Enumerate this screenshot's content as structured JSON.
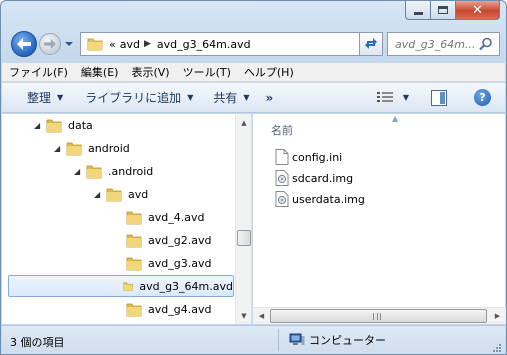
{
  "window": {
    "controls": {
      "minimize": "minimize-icon",
      "maximize": "maximize-icon",
      "close": "close-icon"
    }
  },
  "address": {
    "overflow": "«",
    "crumbs": [
      "avd",
      "avd_g3_64m.avd"
    ]
  },
  "search": {
    "placeholder": "avd_g3_64m..."
  },
  "menu": [
    "ファイル(F)",
    "編集(E)",
    "表示(V)",
    "ツール(T)",
    "ヘルプ(H)"
  ],
  "toolbar": {
    "organize": "整理",
    "library": "ライブラリに追加",
    "share": "共有",
    "more": "»",
    "help": "?"
  },
  "tree": [
    {
      "label": "data",
      "expanded": true
    },
    {
      "label": "android",
      "expanded": true
    },
    {
      "label": ".android",
      "expanded": true
    },
    {
      "label": "avd",
      "expanded": true
    },
    {
      "label": "avd_4.avd"
    },
    {
      "label": "avd_g2.avd"
    },
    {
      "label": "avd_g3.avd"
    },
    {
      "label": "avd_g3_64m.avd",
      "selected": true
    },
    {
      "label": "avd_g4.avd"
    }
  ],
  "content": {
    "column_name": "名前",
    "files": [
      {
        "name": "config.ini",
        "icon": "text-file-icon"
      },
      {
        "name": "sdcard.img",
        "icon": "disc-image-icon"
      },
      {
        "name": "userdata.img",
        "icon": "disc-image-icon"
      }
    ]
  },
  "status": {
    "count": "3 個の項目",
    "zone": "コンピューター"
  },
  "colors": {
    "accent": "#1e395b",
    "folder": "#e8c35a",
    "selection": "#d9e9fb"
  }
}
